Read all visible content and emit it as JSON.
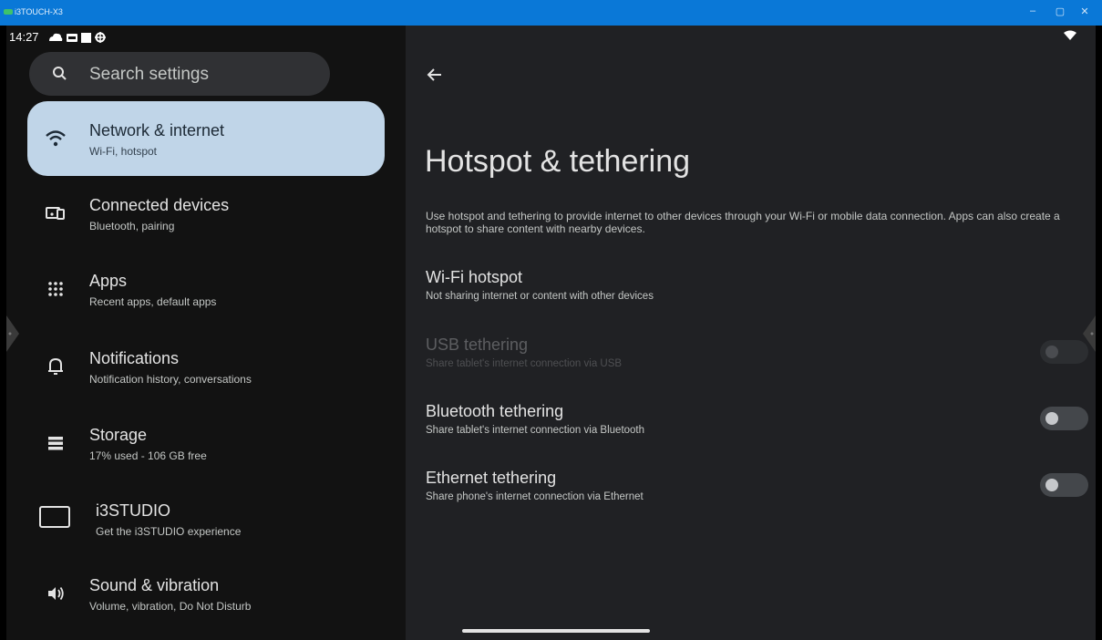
{
  "window": {
    "title": "i3TOUCH-X3",
    "controls": [
      "–",
      "▢",
      "✕"
    ]
  },
  "status_bar": {
    "time": "14:27"
  },
  "search": {
    "placeholder": "Search settings"
  },
  "sidebar": {
    "items": [
      {
        "title": "Network & internet",
        "subtitle": "Wi-Fi, hotspot",
        "icon": "wifi-icon",
        "active": true
      },
      {
        "title": "Connected devices",
        "subtitle": "Bluetooth, pairing",
        "icon": "devices-icon"
      },
      {
        "title": "Apps",
        "subtitle": "Recent apps, default apps",
        "icon": "apps-grid-icon"
      },
      {
        "title": "Notifications",
        "subtitle": "Notification history, conversations",
        "icon": "bell-icon"
      },
      {
        "title": "Storage",
        "subtitle": "17% used - 106 GB free",
        "icon": "storage-icon"
      },
      {
        "title": "i3STUDIO",
        "subtitle": "Get the i3STUDIO experience",
        "icon": "display-icon"
      },
      {
        "title": "Sound & vibration",
        "subtitle": "Volume, vibration, Do Not Disturb",
        "icon": "volume-icon"
      }
    ]
  },
  "detail": {
    "title": "Hotspot & tethering",
    "description": "Use hotspot and tethering to provide internet to other devices through your Wi-Fi or mobile data connection. Apps can also create a hotspot to share content with nearby devices.",
    "prefs": [
      {
        "title": "Wi-Fi hotspot",
        "subtitle": "Not sharing internet or content with other devices",
        "has_toggle": false
      },
      {
        "title": "USB tethering",
        "subtitle": "Share tablet's internet connection via USB",
        "has_toggle": true,
        "enabled": false,
        "on": false
      },
      {
        "title": "Bluetooth tethering",
        "subtitle": "Share tablet's internet connection via Bluetooth",
        "has_toggle": true,
        "enabled": true,
        "on": false
      },
      {
        "title": "Ethernet tethering",
        "subtitle": "Share phone's internet connection via Ethernet",
        "has_toggle": true,
        "enabled": true,
        "on": false
      }
    ]
  },
  "colors": {
    "titlebar": "#0a78d7",
    "active_item": "#c0d5e8",
    "left_bg": "#121212",
    "right_bg": "#202124"
  }
}
